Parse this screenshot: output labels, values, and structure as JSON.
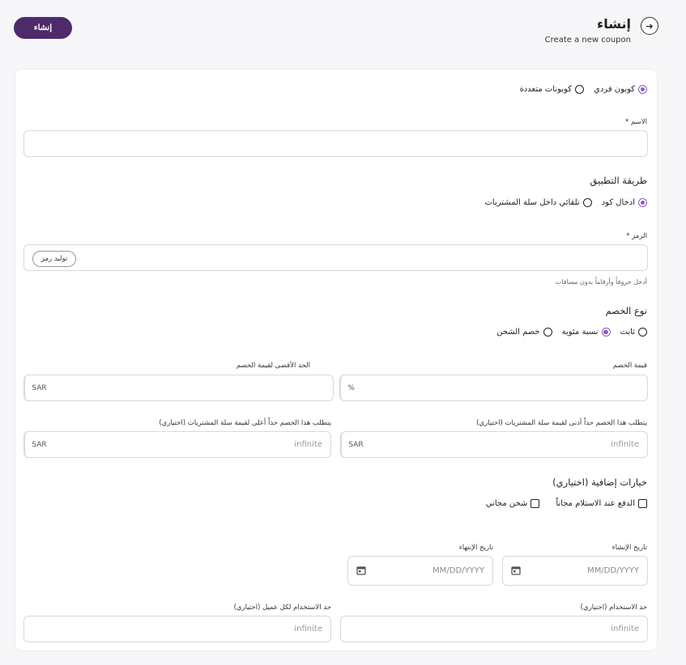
{
  "header": {
    "back_icon": "arrow-right-icon",
    "title": "إنشاء",
    "subtitle": "Create a new coupon",
    "create_button": "إنشاء"
  },
  "coupon_type": {
    "options": [
      {
        "label": "كوبون فردي",
        "selected": true
      },
      {
        "label": "كوبونات متعددة",
        "selected": false
      }
    ]
  },
  "name": {
    "label": "الاسم *",
    "value": ""
  },
  "apply_method": {
    "title": "طريقة التطبيق",
    "options": [
      {
        "label": "ادخال كود",
        "selected": true
      },
      {
        "label": "تلقائي داخل سلة المشتريات",
        "selected": false
      }
    ]
  },
  "code": {
    "label": "الرمز *",
    "value": "",
    "generate_button": "توليد رمز",
    "hint": "أدخل حروفاً وأرقاماً بدون مسافات"
  },
  "discount_type": {
    "title": "نوع الخصم",
    "options": [
      {
        "label": "ثابت",
        "selected": false
      },
      {
        "label": "نسبة مئوية",
        "selected": true
      },
      {
        "label": "خصم الشحن",
        "selected": false
      }
    ]
  },
  "discount_value": {
    "label": "قيمة الخصم",
    "unit": "%",
    "value": ""
  },
  "max_discount": {
    "label": "الحد الأقصى لقيمة الخصم",
    "unit": "SAR",
    "value": ""
  },
  "min_cart": {
    "label": "يتطلب هذا الخصم حداً أدنى لقيمة سلة المشتريات (اختياري)",
    "unit": "SAR",
    "placeholder": "infinite"
  },
  "max_cart": {
    "label": "يتطلب هذا الخصم حداً أعلى لقيمة سلة المشتريات (اختياري)",
    "unit": "SAR",
    "placeholder": "infinite"
  },
  "extra_options": {
    "title": "خيارات إضافية (اختياري)",
    "options": [
      {
        "label": "الدفع عند الاستلام مجاناً",
        "checked": false
      },
      {
        "label": "شحن مجاني",
        "checked": false
      }
    ]
  },
  "start_date": {
    "label": "تاريخ الإنشاء",
    "placeholder": "MM/DD/YYYY",
    "icon": "calendar-icon"
  },
  "end_date": {
    "label": "تاريخ الإنتهاء",
    "placeholder": "MM/DD/YYYY",
    "icon": "calendar-icon"
  },
  "usage_limit": {
    "label": "حد الاستخدام (اختياري)",
    "placeholder": "infinite"
  },
  "usage_per_customer": {
    "label": "حد الاستخدام لكل عميل (اختياري)",
    "placeholder": "infinite"
  }
}
